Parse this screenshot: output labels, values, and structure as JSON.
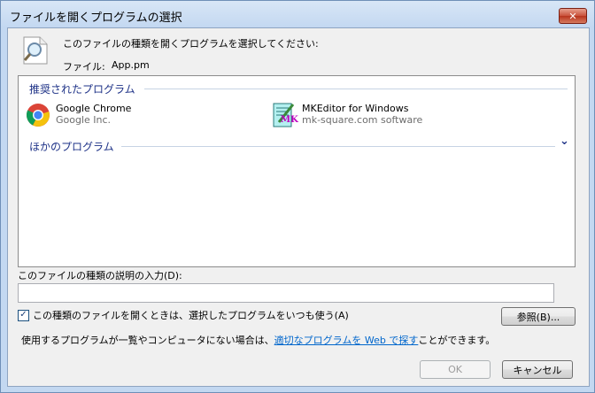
{
  "window": {
    "title": "ファイルを開くプログラムの選択",
    "close_glyph": "✕"
  },
  "header": {
    "prompt": "このファイルの種類を開くプログラムを選択してください:",
    "file_label": "ファイル:",
    "file_name": "App.pm"
  },
  "groups": {
    "recommended": {
      "label": "推奨されたプログラム"
    },
    "other": {
      "label": "ほかのプログラム",
      "chevron": "⌄"
    }
  },
  "apps": [
    {
      "name": "Google Chrome",
      "publisher": "Google Inc."
    },
    {
      "name": "MKEditor for Windows",
      "publisher": "mk-square.com software",
      "icon_text": "MK"
    }
  ],
  "description": {
    "label": "このファイルの種類の説明の入力(D):",
    "value": ""
  },
  "always_use": {
    "label": "この種類のファイルを開くときは、選択したプログラムをいつも使う(A)",
    "checked": true,
    "check_glyph": "✓"
  },
  "buttons": {
    "browse": "参照(B)...",
    "ok": "OK",
    "cancel": "キャンセル"
  },
  "footer": {
    "prefix": "使用するプログラムが一覧やコンピュータにない場合は、",
    "link": "適切なプログラムを Web で探す",
    "suffix": "ことができます。"
  },
  "colors": {
    "group_header": "#1e3287",
    "link": "#0066cc",
    "close_button": "#c9513b"
  }
}
